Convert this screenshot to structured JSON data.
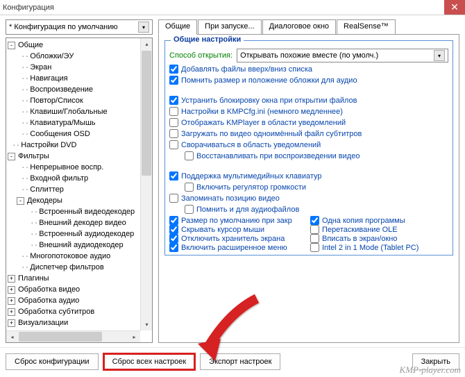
{
  "window": {
    "title": "Конфигурация"
  },
  "config_selector": {
    "value": "* Конфигурация по умолчанию"
  },
  "tree": [
    {
      "level": 0,
      "toggle": "-",
      "label": "Общие"
    },
    {
      "level": 1,
      "toggle": "",
      "label": "Обложки/ЭУ"
    },
    {
      "level": 1,
      "toggle": "",
      "label": "Экран"
    },
    {
      "level": 1,
      "toggle": "",
      "label": "Навигация"
    },
    {
      "level": 1,
      "toggle": "",
      "label": "Воспроизведение"
    },
    {
      "level": 1,
      "toggle": "",
      "label": "Повтор/Список"
    },
    {
      "level": 1,
      "toggle": "",
      "label": "Клавиши/Глобальные"
    },
    {
      "level": 1,
      "toggle": "",
      "label": "Клавиатура/Мышь"
    },
    {
      "level": 1,
      "toggle": "",
      "label": "Сообщения OSD"
    },
    {
      "level": 0,
      "toggle": "",
      "label": "Настройки DVD"
    },
    {
      "level": 0,
      "toggle": "-",
      "label": "Фильтры"
    },
    {
      "level": 1,
      "toggle": "",
      "label": "Непрерывное воспр."
    },
    {
      "level": 1,
      "toggle": "",
      "label": "Входной фильтр"
    },
    {
      "level": 1,
      "toggle": "",
      "label": "Сплиттер"
    },
    {
      "level": 1,
      "toggle": "-",
      "label": "Декодеры"
    },
    {
      "level": 2,
      "toggle": "",
      "label": "Встроенный видеодекодер"
    },
    {
      "level": 2,
      "toggle": "",
      "label": "Внешний декодер видео"
    },
    {
      "level": 2,
      "toggle": "",
      "label": "Встроенный аудиодекодер"
    },
    {
      "level": 2,
      "toggle": "",
      "label": "Внешний аудиодекодер"
    },
    {
      "level": 1,
      "toggle": "",
      "label": "Многопотоковое аудио"
    },
    {
      "level": 1,
      "toggle": "",
      "label": "Диспетчер фильтров"
    },
    {
      "level": 0,
      "toggle": "+",
      "label": "Плагины"
    },
    {
      "level": 0,
      "toggle": "+",
      "label": "Обработка видео"
    },
    {
      "level": 0,
      "toggle": "+",
      "label": "Обработка аудио"
    },
    {
      "level": 0,
      "toggle": "+",
      "label": "Обработка субтитров"
    },
    {
      "level": 0,
      "toggle": "+",
      "label": "Визуализации"
    }
  ],
  "tabs": [
    {
      "label": "Общие",
      "active": true
    },
    {
      "label": "При запуске...",
      "active": false
    },
    {
      "label": "Диалоговое окно",
      "active": false
    },
    {
      "label": "RealSense™",
      "active": false
    }
  ],
  "fieldset": {
    "legend": "Общие настройки"
  },
  "open_method": {
    "label": "Способ открытия:",
    "value": "Открывать похожие вместе (по умолч.)"
  },
  "opts": {
    "o1": {
      "checked": true,
      "label": "Добавлять файлы вверх/вниз списка"
    },
    "o2": {
      "checked": true,
      "label": "Помнить размер и положение обложки для аудио"
    },
    "o3": {
      "checked": true,
      "label": "Устранить блокировку окна при открытии файлов"
    },
    "o4": {
      "checked": false,
      "label": "Настройки в KMPCfg.ini (немного медленнее)"
    },
    "o5": {
      "checked": false,
      "label": "Отображать KMPlayer в области уведомлений"
    },
    "o6": {
      "checked": false,
      "label": "Загружать по видео одноимённый файл субтитров"
    },
    "o7": {
      "checked": false,
      "label": "Сворачиваться в область уведомлений"
    },
    "o8": {
      "checked": false,
      "label": "Восстанавливать при воспроизведении видео"
    },
    "o9": {
      "checked": true,
      "label": "Поддержка мультимедийных клавиатур"
    },
    "o10": {
      "checked": false,
      "label": "Включить регулятор громкости"
    },
    "o11": {
      "checked": false,
      "label": "Запоминать позицию видео"
    },
    "o12": {
      "checked": false,
      "label": "Помнить и для аудиофайлов"
    },
    "o13": {
      "checked": true,
      "label": "Размер по умолчанию при закр"
    },
    "o14": {
      "checked": true,
      "label": "Одна копия программы"
    },
    "o15": {
      "checked": true,
      "label": "Скрывать курсор мыши"
    },
    "o16": {
      "checked": false,
      "label": "Перетаскивание OLE"
    },
    "o17": {
      "checked": true,
      "label": "Отключить хранитель экрана"
    },
    "o18": {
      "checked": false,
      "label": "Вписать в экран/окно"
    },
    "o19": {
      "checked": true,
      "label": "Включить расширенное меню"
    },
    "o20": {
      "checked": false,
      "label": "Intel 2 in 1 Mode (Tablet PC)"
    }
  },
  "buttons": {
    "reset_config": "Сброс конфигурации",
    "reset_all": "Сброс всех настроек",
    "export": "Экспорт настроек",
    "close": "Закрыть"
  },
  "watermark": "KMP-player.com"
}
